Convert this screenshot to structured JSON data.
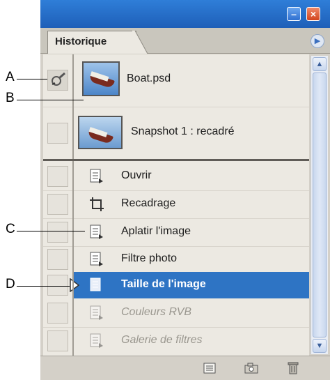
{
  "panel": {
    "tab_label": "Historique",
    "menu_icon": "panel-menu-arrow-icon"
  },
  "snapshots": [
    {
      "label": "Boat.psd",
      "icon": "history-brush-icon"
    },
    {
      "label": "Snapshot 1 : recadré"
    }
  ],
  "steps": [
    {
      "label": "Ouvrir",
      "icon": "document-step-icon",
      "state": "normal"
    },
    {
      "label": "Recadrage",
      "icon": "crop-icon",
      "state": "normal"
    },
    {
      "label": "Aplatir l'image",
      "icon": "document-step-icon",
      "state": "normal"
    },
    {
      "label": "Filtre photo",
      "icon": "document-step-icon",
      "state": "normal"
    },
    {
      "label": "Taille de l'image",
      "icon": "document-step-icon",
      "state": "selected"
    },
    {
      "label": "Couleurs RVB",
      "icon": "document-step-icon",
      "state": "dimmed"
    },
    {
      "label": "Galerie de filtres",
      "icon": "document-step-icon",
      "state": "dimmed"
    }
  ],
  "callouts": [
    "A",
    "B",
    "C",
    "D"
  ],
  "toolbar": {
    "new_document_icon": "new-document-from-state-icon",
    "snapshot_icon": "camera-snapshot-icon",
    "delete_icon": "trash-icon"
  },
  "colors": {
    "selection": "#2e74c4",
    "titlebar": "#2f7ed8"
  }
}
